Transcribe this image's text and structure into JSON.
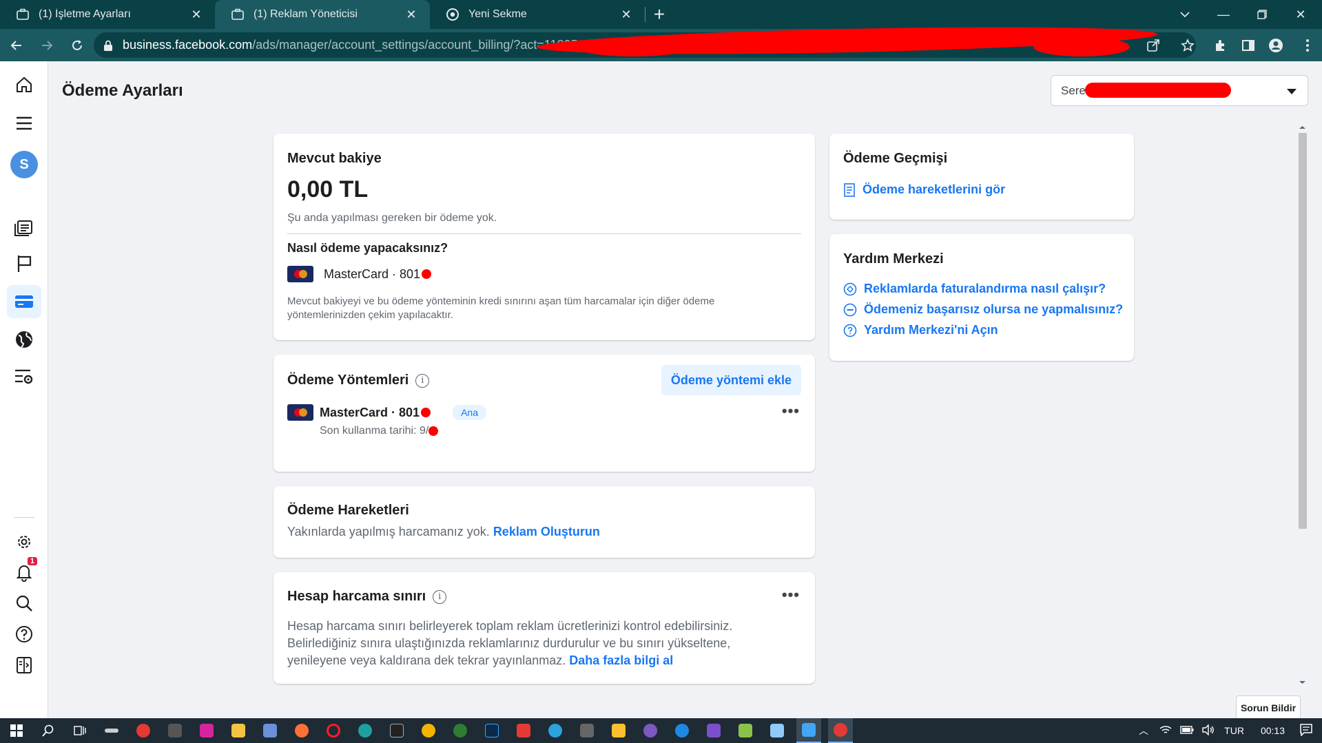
{
  "browser": {
    "tabs": [
      {
        "label": "(1) İşletme Ayarları",
        "active": false
      },
      {
        "label": "(1) Reklam Yöneticisi",
        "active": true
      },
      {
        "label": "Yeni Sekme",
        "active": false
      }
    ],
    "url_host": "business.facebook.com",
    "url_path": "/ads/manager/account_settings/account_billing/?act=11895"
  },
  "page": {
    "title": "Ödeme Ayarları",
    "account_selector": "Sere"
  },
  "balance": {
    "title": "Mevcut bakiye",
    "amount": "0,00 TL",
    "status": "Şu anda yapılması gereken bir ödeme yok.",
    "how_title": "Nasıl ödeme yapacaksınız?",
    "card": "MasterCard · 801",
    "note": "Mevcut bakiyeyi ve bu ödeme yönteminin kredi sınırını aşan tüm harcamalar için diğer ödeme yöntemlerinizden çekim yapılacaktır."
  },
  "methods": {
    "title": "Ödeme Yöntemleri",
    "add_button": "Ödeme yöntemi ekle",
    "card": "MasterCard · 801",
    "badge": "Ana",
    "expiry": "Son kullanma tarihi: 9/"
  },
  "transactions": {
    "title": "Ödeme Hareketleri",
    "text": "Yakınlarda yapılmış harcamanız yok.",
    "link": "Reklam Oluşturun"
  },
  "spend_limit": {
    "title": "Hesap harcama sınırı",
    "text": "Hesap harcama sınırı belirleyerek toplam reklam ücretlerinizi kontrol edebilirsiniz. Belirlediğiniz sınıra ulaştığınızda reklamlarınız durdurulur ve bu sınırı yükseltene, yenileyene veya kaldırana dek tekrar yayınlanmaz.",
    "link": "Daha fazla bilgi al"
  },
  "history": {
    "title": "Ödeme Geçmişi",
    "link": "Ödeme hareketlerini gör"
  },
  "help": {
    "title": "Yardım Merkezi",
    "links": [
      "Reklamlarda faturalandırma nasıl çalışır?",
      "Ödemeniz başarısız olursa ne yapmalısınız?",
      "Yardım Merkezi'ni Açın"
    ]
  },
  "rail": {
    "avatar_letter": "S",
    "notification_count": "1"
  },
  "report_button": "Sorun Bildir",
  "taskbar": {
    "language": "TUR",
    "time": "00:13"
  },
  "colors": {
    "chrome_dark": "#0a4147",
    "chrome_tab": "#1b5a60",
    "link_blue": "#1877f2",
    "page_bg": "#f0f2f5"
  }
}
